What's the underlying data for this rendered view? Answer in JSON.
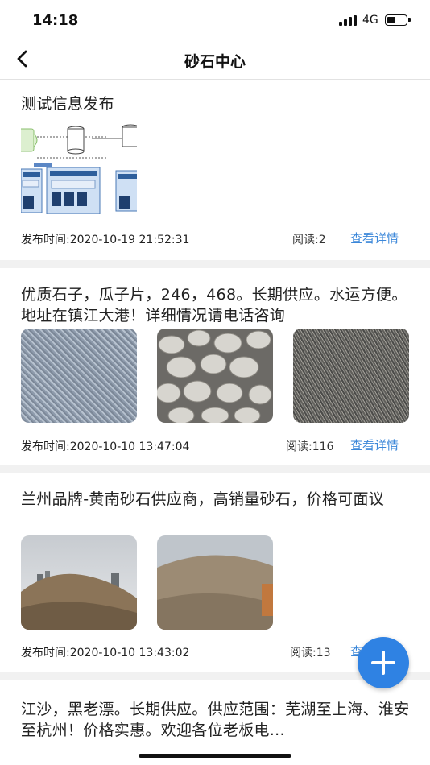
{
  "status_bar": {
    "time": "14:18",
    "network": "4G"
  },
  "nav": {
    "title": "砂石中心",
    "back_icon": "chevron-left-icon"
  },
  "posts": [
    {
      "title": "测试信息发布",
      "publish_time": "发布时间:2020-10-19 21:52:31",
      "reads": "阅读:2",
      "detail_label": "查看详情",
      "images": [
        "architecture-diagram"
      ]
    },
    {
      "title": "优质石子，瓜子片，246，468。长期供应。水运方便。地址在镇江大港！详细情况请电话咨询",
      "publish_time": "发布时间:2020-10-10 13:47:04",
      "reads": "阅读:116",
      "detail_label": "查看详情",
      "images": [
        "gravel-photo",
        "stones-photo",
        "gravel-dark-photo"
      ]
    },
    {
      "title": "兰州品牌-黄南砂石供应商，高销量砂石，价格可面议",
      "publish_time": "发布时间:2020-10-10 13:43:02",
      "reads": "阅读:13",
      "detail_label": "查看详情",
      "images": [
        "sand-pile-photo",
        "sand-pile-photo"
      ]
    },
    {
      "title": "江沙，黑老漂。长期供应。供应范围：芜湖至上海、淮安至杭州！价格实惠。欢迎各位老板电..."
    }
  ],
  "fab": {
    "icon": "plus-icon"
  },
  "colors": {
    "accent": "#3b87d9",
    "fab": "#2f82e3",
    "separator": "#f1f1f1"
  }
}
